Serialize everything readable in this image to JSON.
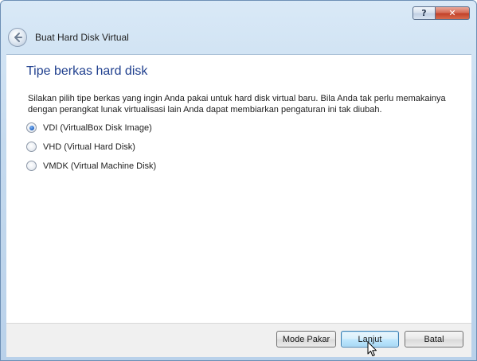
{
  "window": {
    "title": "Buat Hard Disk Virtual",
    "help_button": "?",
    "close_button": "✕"
  },
  "content": {
    "heading": "Tipe berkas hard disk",
    "description": "Silakan pilih tipe berkas yang ingin Anda pakai untuk hard disk virtual baru. Bila Anda tak perlu memakainya dengan perangkat lunak virtualisasi lain Anda dapat membiarkan pengaturan ini tak diubah.",
    "options": [
      {
        "label": "VDI (VirtualBox Disk Image)",
        "checked": true
      },
      {
        "label": "VHD (Virtual Hard Disk)",
        "checked": false
      },
      {
        "label": "VMDK (Virtual Machine Disk)",
        "checked": false
      }
    ]
  },
  "footer": {
    "expert_mode_label": "Mode Pakar",
    "next_label": "Lanjut",
    "cancel_label": "Batal"
  },
  "colors": {
    "heading": "#1f3f8e",
    "frame": "#c5daee",
    "primary_border": "#3c7fb1"
  }
}
